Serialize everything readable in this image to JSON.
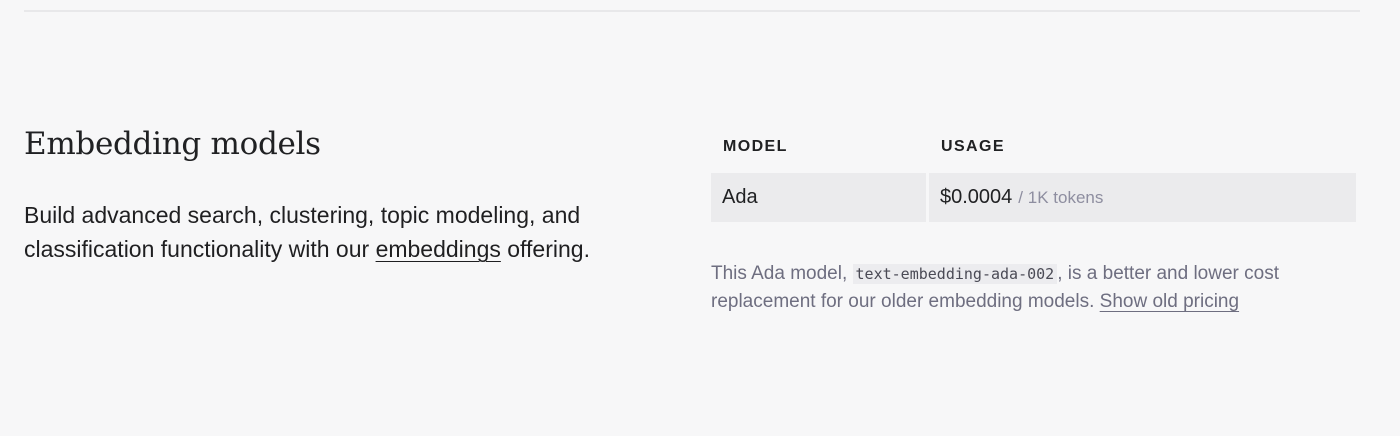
{
  "section": {
    "title": "Embedding models",
    "description_before_link": "Build advanced search, clustering, topic modeling, and classification functionality with our ",
    "description_link": "embeddings",
    "description_after_link": " offering."
  },
  "pricing_table": {
    "headers": {
      "model": "MODEL",
      "usage": "USAGE"
    },
    "rows": [
      {
        "model": "Ada",
        "price": "$0.0004",
        "unit": "/ 1K tokens"
      }
    ]
  },
  "footnote": {
    "text_before_code": "This Ada model, ",
    "code": "text-embedding-ada-002",
    "text_after_code": ", is a better and lower cost replacement for our older embedding models. ",
    "link": "Show old pricing"
  }
}
